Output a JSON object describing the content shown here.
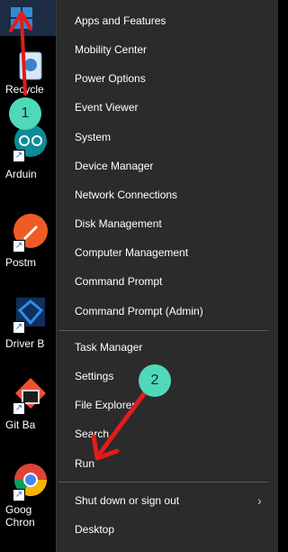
{
  "desktop": {
    "icons": [
      {
        "name": "recycle-bin",
        "line1": "Recycle",
        "line2": ""
      },
      {
        "name": "arduino",
        "line1": "Arduin",
        "line2": ""
      },
      {
        "name": "postman",
        "line1": "Postm",
        "line2": ""
      },
      {
        "name": "driver-booster",
        "line1": "Driver B",
        "line2": ""
      },
      {
        "name": "git-bash",
        "line1": "Git Ba",
        "line2": ""
      },
      {
        "name": "google-chrome",
        "line1": "Goog",
        "line2": "Chron"
      }
    ]
  },
  "menu": {
    "items": [
      "Apps and Features",
      "Mobility Center",
      "Power Options",
      "Event Viewer",
      "System",
      "Device Manager",
      "Network Connections",
      "Disk Management",
      "Computer Management",
      "Command Prompt",
      "Command Prompt (Admin)",
      "Task Manager",
      "Settings",
      "File Explorer",
      "Search",
      "Run",
      "Shut down or sign out",
      "Desktop"
    ],
    "submenu_indicator": "›"
  },
  "annotations": {
    "step1": "1",
    "step2": "2",
    "arrow_color": "#e31b1b",
    "badge_color": "#4fd9b9"
  }
}
